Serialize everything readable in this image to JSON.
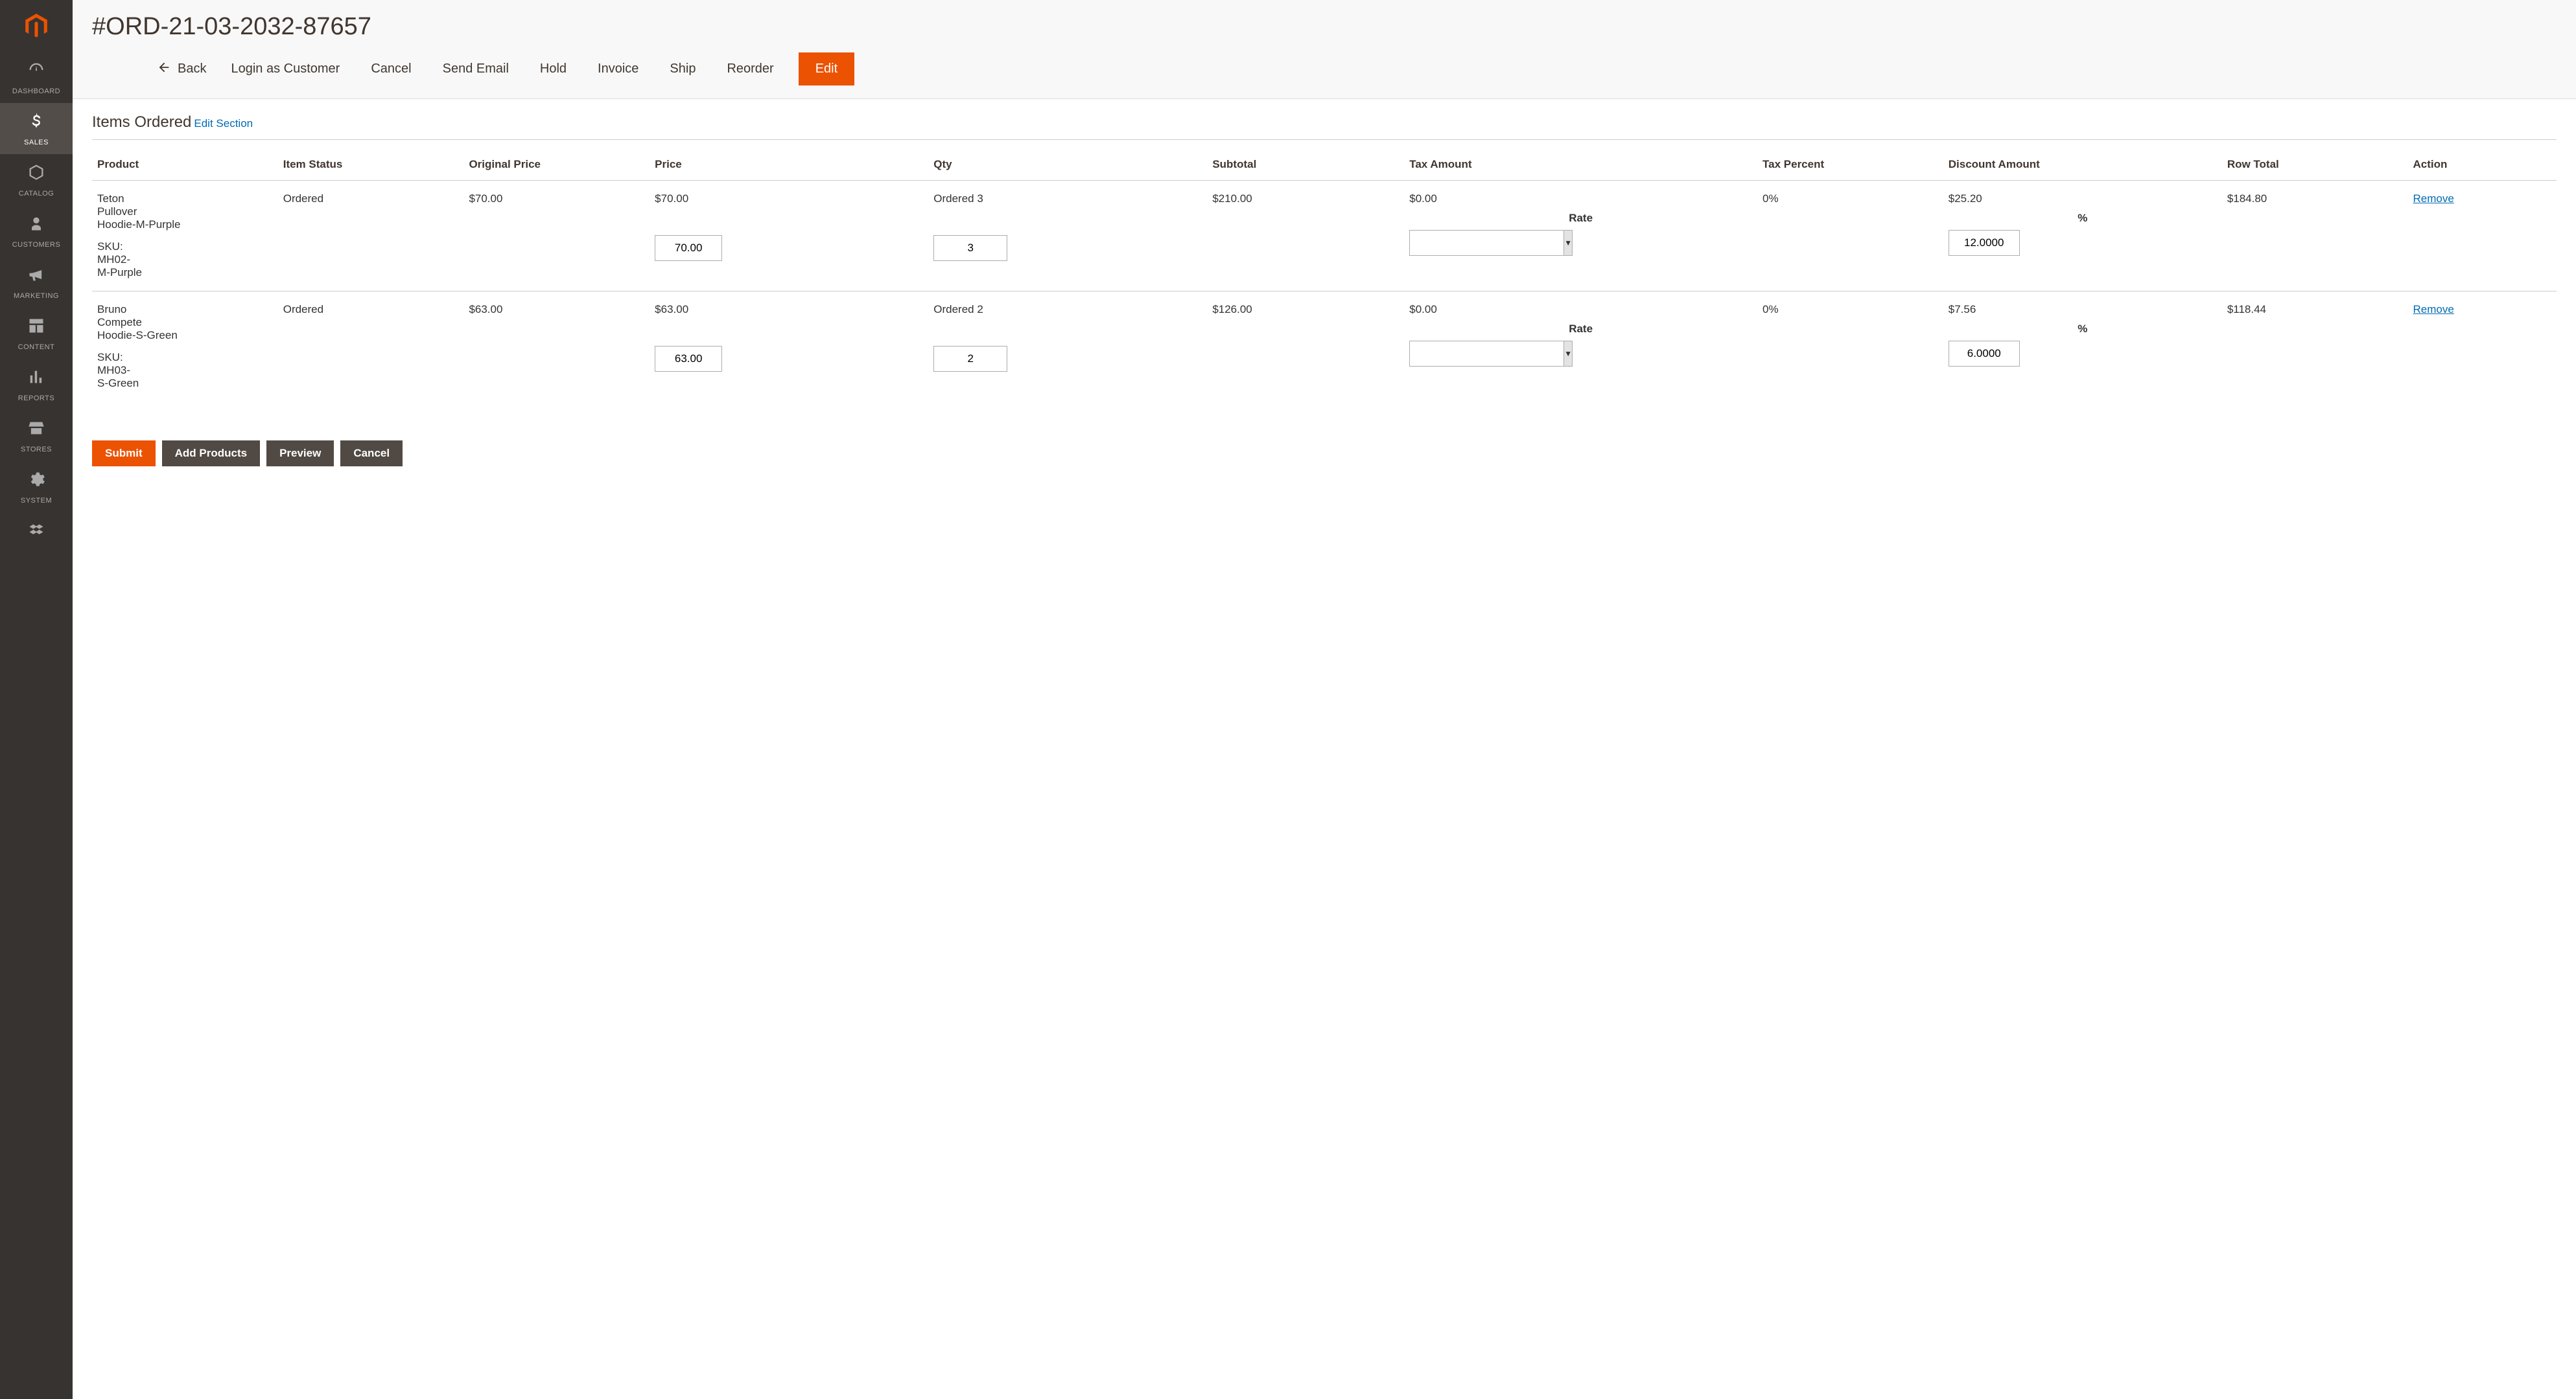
{
  "sidebar": {
    "items": [
      {
        "label": "DASHBOARD"
      },
      {
        "label": "SALES"
      },
      {
        "label": "CATALOG"
      },
      {
        "label": "CUSTOMERS"
      },
      {
        "label": "MARKETING"
      },
      {
        "label": "CONTENT"
      },
      {
        "label": "REPORTS"
      },
      {
        "label": "STORES"
      },
      {
        "label": "SYSTEM"
      }
    ]
  },
  "header": {
    "title": "#ORD-21-03-2032-87657",
    "back": "Back",
    "actions": {
      "login_as_customer": "Login as Customer",
      "cancel": "Cancel",
      "send_email": "Send Email",
      "hold": "Hold",
      "invoice": "Invoice",
      "ship": "Ship",
      "reorder": "Reorder",
      "edit": "Edit"
    }
  },
  "section": {
    "title": "Items Ordered",
    "edit_link": "Edit Section"
  },
  "table": {
    "headers": {
      "product": "Product",
      "item_status": "Item Status",
      "original_price": "Original Price",
      "price": "Price",
      "qty": "Qty",
      "subtotal": "Subtotal",
      "tax_amount": "Tax Amount",
      "tax_percent": "Tax Percent",
      "discount_amount": "Discount Amount",
      "row_total": "Row Total",
      "action": "Action"
    },
    "sublabels": {
      "rate": "Rate",
      "pct": "%",
      "sku_prefix": "SKU:",
      "ordered_prefix": "Ordered"
    },
    "rows": [
      {
        "name": "Teton Pullover Hoodie-M-Purple",
        "sku": "MH02-M-Purple",
        "status": "Ordered",
        "orig_price": "$70.00",
        "price_display": "$70.00",
        "price_input": "70.00",
        "qty_ordered": "3",
        "qty_input": "3",
        "subtotal": "$210.00",
        "tax_amount": "$0.00",
        "tax_rate_input": "",
        "tax_percent": "0%",
        "discount_amount": "$25.20",
        "discount_pct_input": "12.0000",
        "row_total": "$184.80",
        "action": "Remove"
      },
      {
        "name": "Bruno Compete Hoodie-S-Green",
        "sku": "MH03-S-Green",
        "status": "Ordered",
        "orig_price": "$63.00",
        "price_display": "$63.00",
        "price_input": "63.00",
        "qty_ordered": "2",
        "qty_input": "2",
        "subtotal": "$126.00",
        "tax_amount": "$0.00",
        "tax_rate_input": "",
        "tax_percent": "0%",
        "discount_amount": "$7.56",
        "discount_pct_input": "6.0000",
        "row_total": "$118.44",
        "action": "Remove"
      }
    ]
  },
  "buttons": {
    "submit": "Submit",
    "add_products": "Add Products",
    "preview": "Preview",
    "cancel": "Cancel"
  }
}
